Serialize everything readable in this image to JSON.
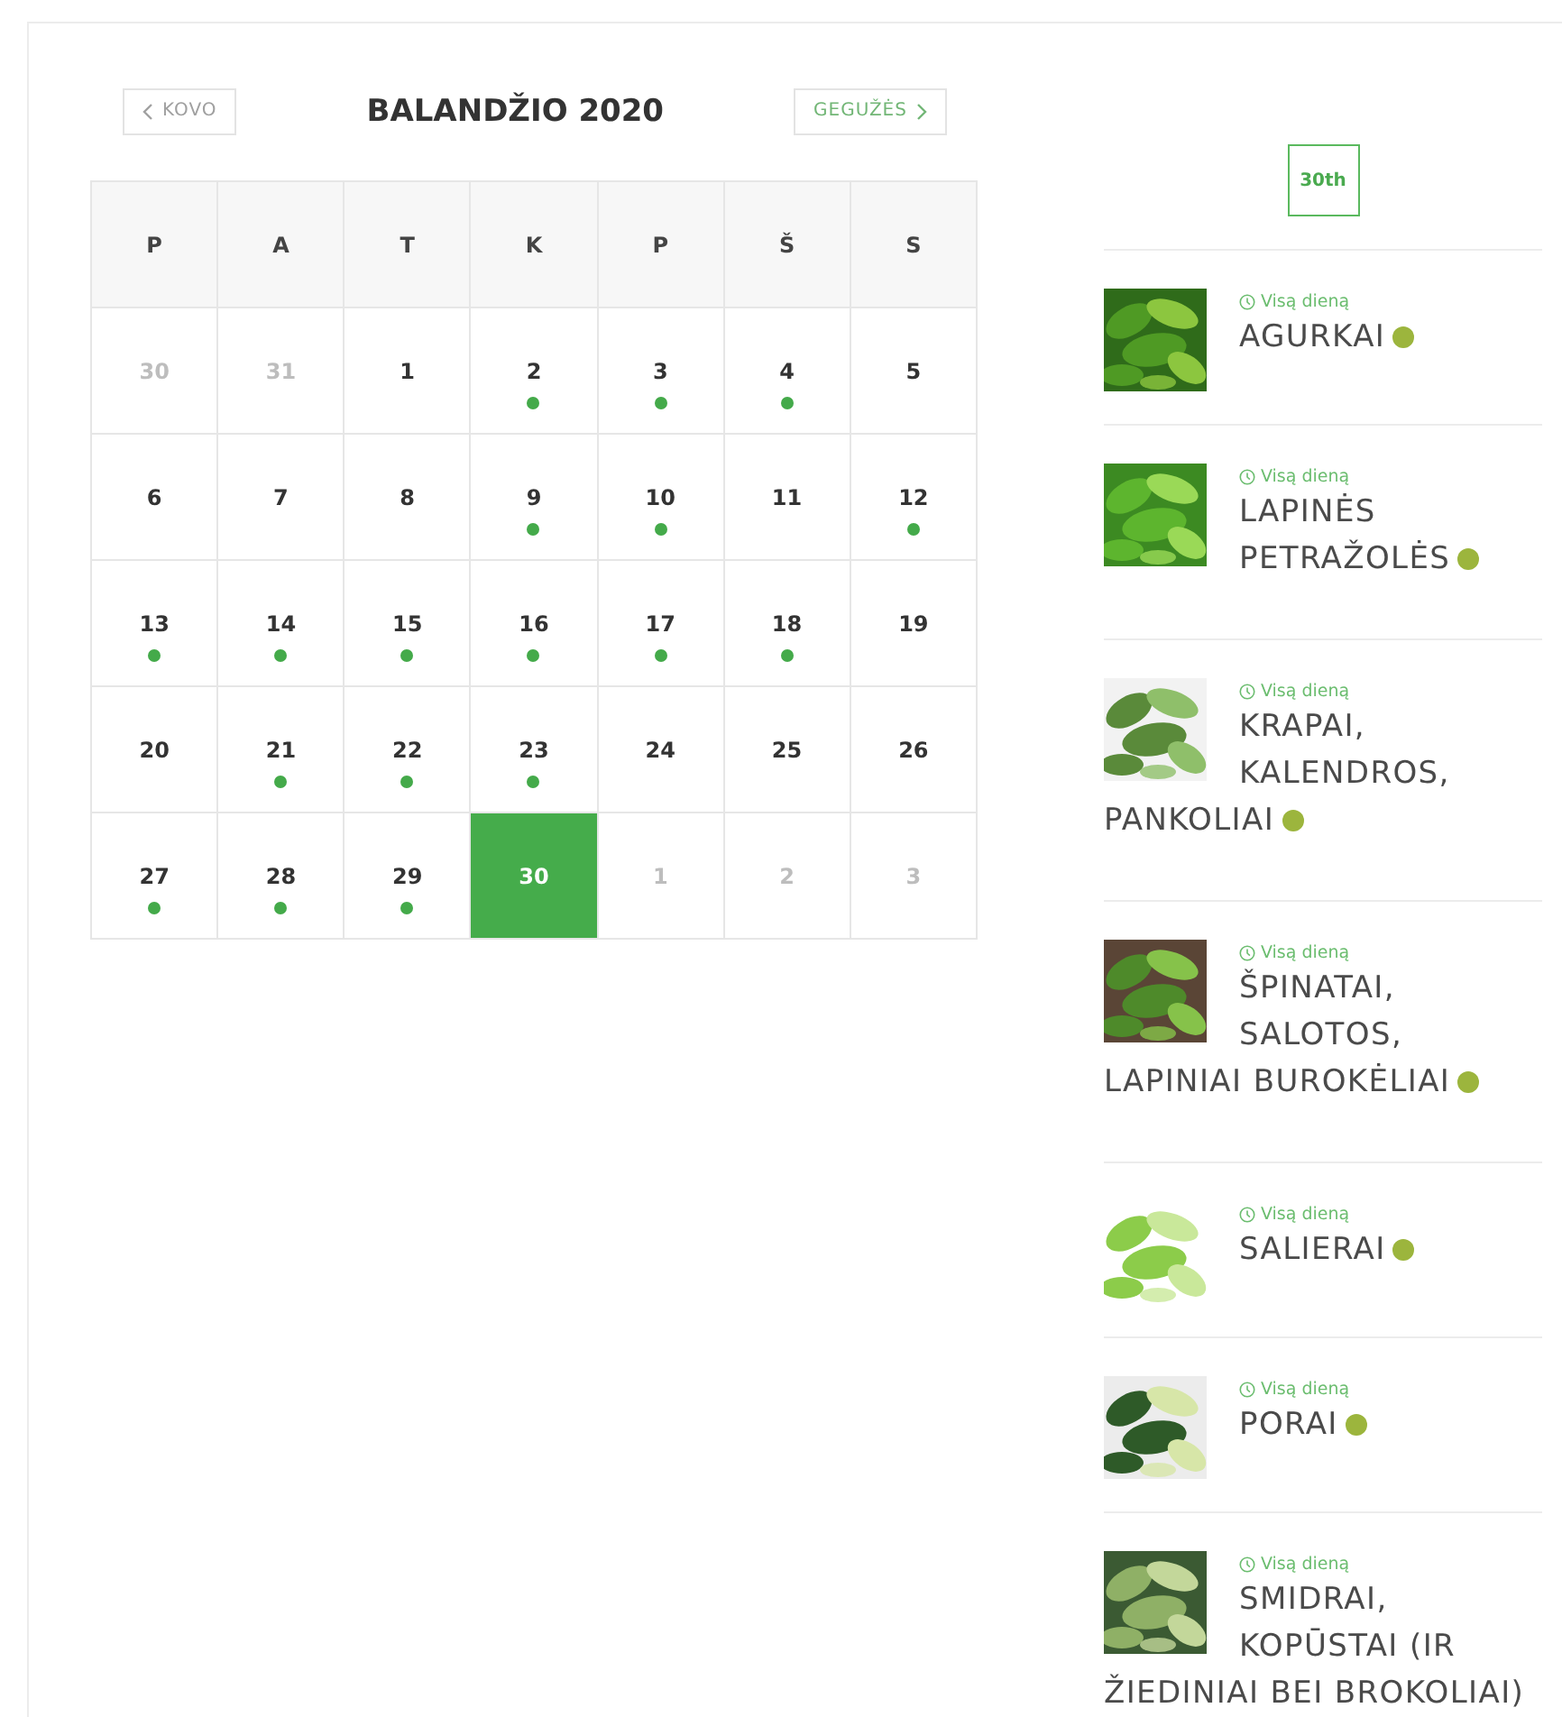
{
  "calendar": {
    "prev": "KOVO",
    "title": "BALANDŽIO 2020",
    "next": "GEGUŽĖS",
    "weekdays": [
      "P",
      "A",
      "T",
      "K",
      "P",
      "Š",
      "S"
    ],
    "weeks": [
      [
        {
          "day": "30",
          "muted": true,
          "events": false,
          "selected": false
        },
        {
          "day": "31",
          "muted": true,
          "events": false,
          "selected": false
        },
        {
          "day": "1",
          "muted": false,
          "events": false,
          "selected": false
        },
        {
          "day": "2",
          "muted": false,
          "events": true,
          "selected": false
        },
        {
          "day": "3",
          "muted": false,
          "events": true,
          "selected": false
        },
        {
          "day": "4",
          "muted": false,
          "events": true,
          "selected": false
        },
        {
          "day": "5",
          "muted": false,
          "events": false,
          "selected": false
        }
      ],
      [
        {
          "day": "6",
          "muted": false,
          "events": false,
          "selected": false
        },
        {
          "day": "7",
          "muted": false,
          "events": false,
          "selected": false
        },
        {
          "day": "8",
          "muted": false,
          "events": false,
          "selected": false
        },
        {
          "day": "9",
          "muted": false,
          "events": true,
          "selected": false
        },
        {
          "day": "10",
          "muted": false,
          "events": true,
          "selected": false
        },
        {
          "day": "11",
          "muted": false,
          "events": false,
          "selected": false
        },
        {
          "day": "12",
          "muted": false,
          "events": true,
          "selected": false
        }
      ],
      [
        {
          "day": "13",
          "muted": false,
          "events": true,
          "selected": false
        },
        {
          "day": "14",
          "muted": false,
          "events": true,
          "selected": false
        },
        {
          "day": "15",
          "muted": false,
          "events": true,
          "selected": false
        },
        {
          "day": "16",
          "muted": false,
          "events": true,
          "selected": false
        },
        {
          "day": "17",
          "muted": false,
          "events": true,
          "selected": false
        },
        {
          "day": "18",
          "muted": false,
          "events": true,
          "selected": false
        },
        {
          "day": "19",
          "muted": false,
          "events": false,
          "selected": false
        }
      ],
      [
        {
          "day": "20",
          "muted": false,
          "events": false,
          "selected": false
        },
        {
          "day": "21",
          "muted": false,
          "events": true,
          "selected": false
        },
        {
          "day": "22",
          "muted": false,
          "events": true,
          "selected": false
        },
        {
          "day": "23",
          "muted": false,
          "events": true,
          "selected": false
        },
        {
          "day": "24",
          "muted": false,
          "events": false,
          "selected": false
        },
        {
          "day": "25",
          "muted": false,
          "events": false,
          "selected": false
        },
        {
          "day": "26",
          "muted": false,
          "events": false,
          "selected": false
        }
      ],
      [
        {
          "day": "27",
          "muted": false,
          "events": true,
          "selected": false
        },
        {
          "day": "28",
          "muted": false,
          "events": true,
          "selected": false
        },
        {
          "day": "29",
          "muted": false,
          "events": true,
          "selected": false
        },
        {
          "day": "30",
          "muted": false,
          "events": false,
          "selected": true
        },
        {
          "day": "1",
          "muted": true,
          "events": false,
          "selected": false
        },
        {
          "day": "2",
          "muted": true,
          "events": false,
          "selected": false
        },
        {
          "day": "3",
          "muted": true,
          "events": false,
          "selected": false
        }
      ]
    ]
  },
  "agenda": {
    "date": "30th",
    "events": [
      {
        "time": "Visą dieną",
        "title": "AGURKAI",
        "dot": true
      },
      {
        "time": "Visą dieną",
        "title": "LAPINĖS PETRAŽOLĖS",
        "dot": true
      },
      {
        "time": "Visą dieną",
        "title": "KRAPAI, KALENDROS, PANKOLIAI",
        "dot": true
      },
      {
        "time": "Visą dieną",
        "title": "ŠPINATAI, SALOTOS, LAPINIAI BUROKĖLIAI",
        "dot": true
      },
      {
        "time": "Visą dieną",
        "title": "SALIERAI",
        "dot": true
      },
      {
        "time": "Visą dieną",
        "title": "PORAI",
        "dot": true
      },
      {
        "time": "Visą dieną",
        "title": "SMIDRAI, KOPŪSTAI (IR ŽIEDINIAI BEI BROKOLIAI)",
        "dot": false
      }
    ]
  }
}
